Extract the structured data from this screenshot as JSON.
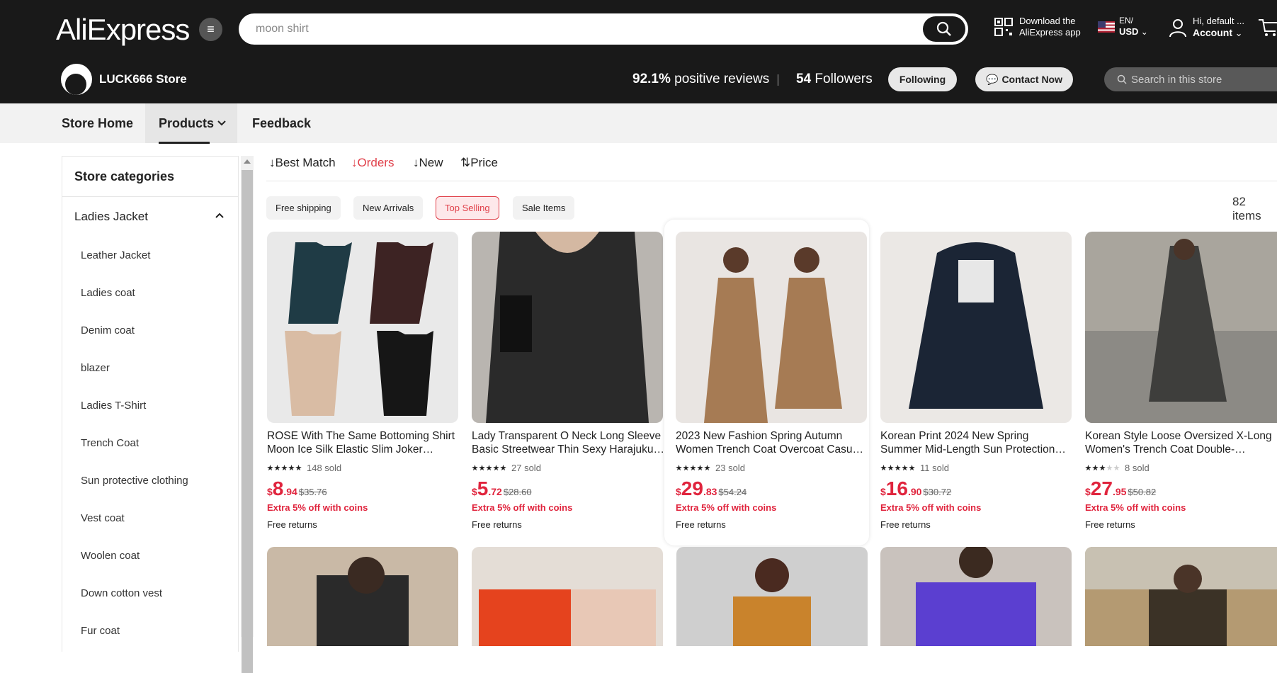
{
  "header": {
    "logo": "AliExpress",
    "search_value": "moon shirt",
    "download_line1": "Download the",
    "download_line2": "AliExpress app",
    "lang_line1": "EN/",
    "lang_line2": "USD",
    "account_line1": "Hi, default ...",
    "account_line2": "Account"
  },
  "store": {
    "name": "LUCK666 Store",
    "rating_value": "92.1%",
    "rating_label": "positive reviews",
    "followers_count": "54",
    "followers_label": "Followers",
    "following_label": "Following",
    "contact_label": "Contact Now",
    "search_placeholder": "Search in this store"
  },
  "nav": {
    "home": "Store Home",
    "products": "Products",
    "feedback": "Feedback"
  },
  "sidebar": {
    "title": "Store categories",
    "parent": "Ladies Jacket",
    "items": [
      "Leather Jacket",
      "Ladies coat",
      "Denim coat",
      "blazer",
      "Ladies T-Shirt",
      "Trench Coat",
      "Sun protective clothing",
      "Vest coat",
      "Woolen coat",
      "Down cotton vest",
      "Fur coat"
    ]
  },
  "sort": {
    "best_match": "Best Match",
    "orders": "Orders",
    "new": "New",
    "price": "Price"
  },
  "filters": {
    "free_shipping": "Free shipping",
    "new_arrivals": "New Arrivals",
    "top_selling": "Top Selling",
    "sale_items": "Sale Items",
    "items_count": "82 items"
  },
  "products": [
    {
      "title": "ROSE With The Same Bottoming Shirt Moon Ice Silk Elastic Slim Joker Undershirt",
      "rating": 4.5,
      "sold": "148 sold",
      "cur": "$",
      "int": "8",
      "dec": ".94",
      "orig": "$35.76",
      "extra": "Extra 5% off with coins",
      "returns": "Free returns"
    },
    {
      "title": "Lady Transparent O Neck Long Sleeve Basic Streetwear Thin Sexy Harajuku Mesh Top",
      "rating": 5,
      "sold": "27 sold",
      "cur": "$",
      "int": "5",
      "dec": ".72",
      "orig": "$28.60",
      "extra": "Extra 5% off with coins",
      "returns": "Free returns"
    },
    {
      "title": "2023 New Fashion Spring Autumn Women Trench Coat Overcoat Casual Long Coat",
      "rating": 5,
      "sold": "23 sold",
      "cur": "$",
      "int": "29",
      "dec": ".83",
      "orig": "$54.24",
      "extra": "Extra 5% off with coins",
      "returns": "Free returns"
    },
    {
      "title": "Korean Print 2024 New Spring Summer Mid-Length Sun Protection Jacket Hooded",
      "rating": 5,
      "sold": "11 sold",
      "cur": "$",
      "int": "16",
      "dec": ".90",
      "orig": "$30.72",
      "extra": "Extra 5% off with coins",
      "returns": "Free returns"
    },
    {
      "title": "Korean Style Loose Oversized X-Long Women's Trench Coat Double-Breasted Belted",
      "rating": 3,
      "sold": "8 sold",
      "cur": "$",
      "int": "27",
      "dec": ".95",
      "orig": "$50.82",
      "extra": "Extra 5% off with coins",
      "returns": "Free returns"
    }
  ]
}
